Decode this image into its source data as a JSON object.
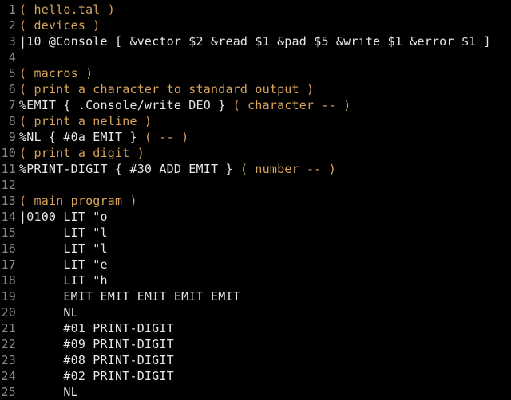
{
  "lines": [
    {
      "n": "1",
      "segments": [
        {
          "cls": "cmt",
          "text": "( hello.tal )"
        }
      ]
    },
    {
      "n": "2",
      "segments": [
        {
          "cls": "cmt",
          "text": "( devices )"
        }
      ]
    },
    {
      "n": "3",
      "segments": [
        {
          "cls": "kw",
          "text": "|10 @Console [ &vector $2 &read $1 &pad $5 &write $1 &error $1 ]"
        }
      ]
    },
    {
      "n": "4",
      "segments": []
    },
    {
      "n": "5",
      "segments": [
        {
          "cls": "cmt",
          "text": "( macros )"
        }
      ]
    },
    {
      "n": "6",
      "segments": [
        {
          "cls": "cmt",
          "text": "( print a character to standard output )"
        }
      ]
    },
    {
      "n": "7",
      "segments": [
        {
          "cls": "kw",
          "text": "%EMIT { .Console/write DEO } "
        },
        {
          "cls": "cmt",
          "text": "( character -- )"
        }
      ]
    },
    {
      "n": "8",
      "segments": [
        {
          "cls": "cmt",
          "text": "( print a neline )"
        }
      ]
    },
    {
      "n": "9",
      "segments": [
        {
          "cls": "kw",
          "text": "%NL { #0a EMIT } "
        },
        {
          "cls": "cmt",
          "text": "( -- )"
        }
      ]
    },
    {
      "n": "10",
      "segments": [
        {
          "cls": "cmt",
          "text": "( print a digit )"
        }
      ]
    },
    {
      "n": "11",
      "segments": [
        {
          "cls": "kw",
          "text": "%PRINT-DIGIT { #30 ADD EMIT } "
        },
        {
          "cls": "cmt",
          "text": "( number -- )"
        }
      ]
    },
    {
      "n": "12",
      "segments": []
    },
    {
      "n": "13",
      "segments": [
        {
          "cls": "cmt",
          "text": "( main program )"
        }
      ]
    },
    {
      "n": "14",
      "segments": [
        {
          "cls": "kw",
          "text": "|0100 LIT \"o"
        }
      ]
    },
    {
      "n": "15",
      "segments": [
        {
          "cls": "kw",
          "text": "      LIT \"l"
        }
      ]
    },
    {
      "n": "16",
      "segments": [
        {
          "cls": "kw",
          "text": "      LIT \"l"
        }
      ]
    },
    {
      "n": "17",
      "segments": [
        {
          "cls": "kw",
          "text": "      LIT \"e"
        }
      ]
    },
    {
      "n": "18",
      "segments": [
        {
          "cls": "kw",
          "text": "      LIT \"h"
        }
      ]
    },
    {
      "n": "19",
      "segments": [
        {
          "cls": "kw",
          "text": "      EMIT EMIT EMIT EMIT EMIT"
        }
      ]
    },
    {
      "n": "20",
      "segments": [
        {
          "cls": "kw",
          "text": "      NL"
        }
      ]
    },
    {
      "n": "21",
      "segments": [
        {
          "cls": "kw",
          "text": "      #01 PRINT-DIGIT"
        }
      ]
    },
    {
      "n": "22",
      "segments": [
        {
          "cls": "kw",
          "text": "      #09 PRINT-DIGIT"
        }
      ]
    },
    {
      "n": "23",
      "segments": [
        {
          "cls": "kw",
          "text": "      #08 PRINT-DIGIT"
        }
      ]
    },
    {
      "n": "24",
      "segments": [
        {
          "cls": "kw",
          "text": "      #02 PRINT-DIGIT"
        }
      ]
    },
    {
      "n": "25",
      "segments": [
        {
          "cls": "kw",
          "text": "      NL"
        }
      ]
    }
  ]
}
